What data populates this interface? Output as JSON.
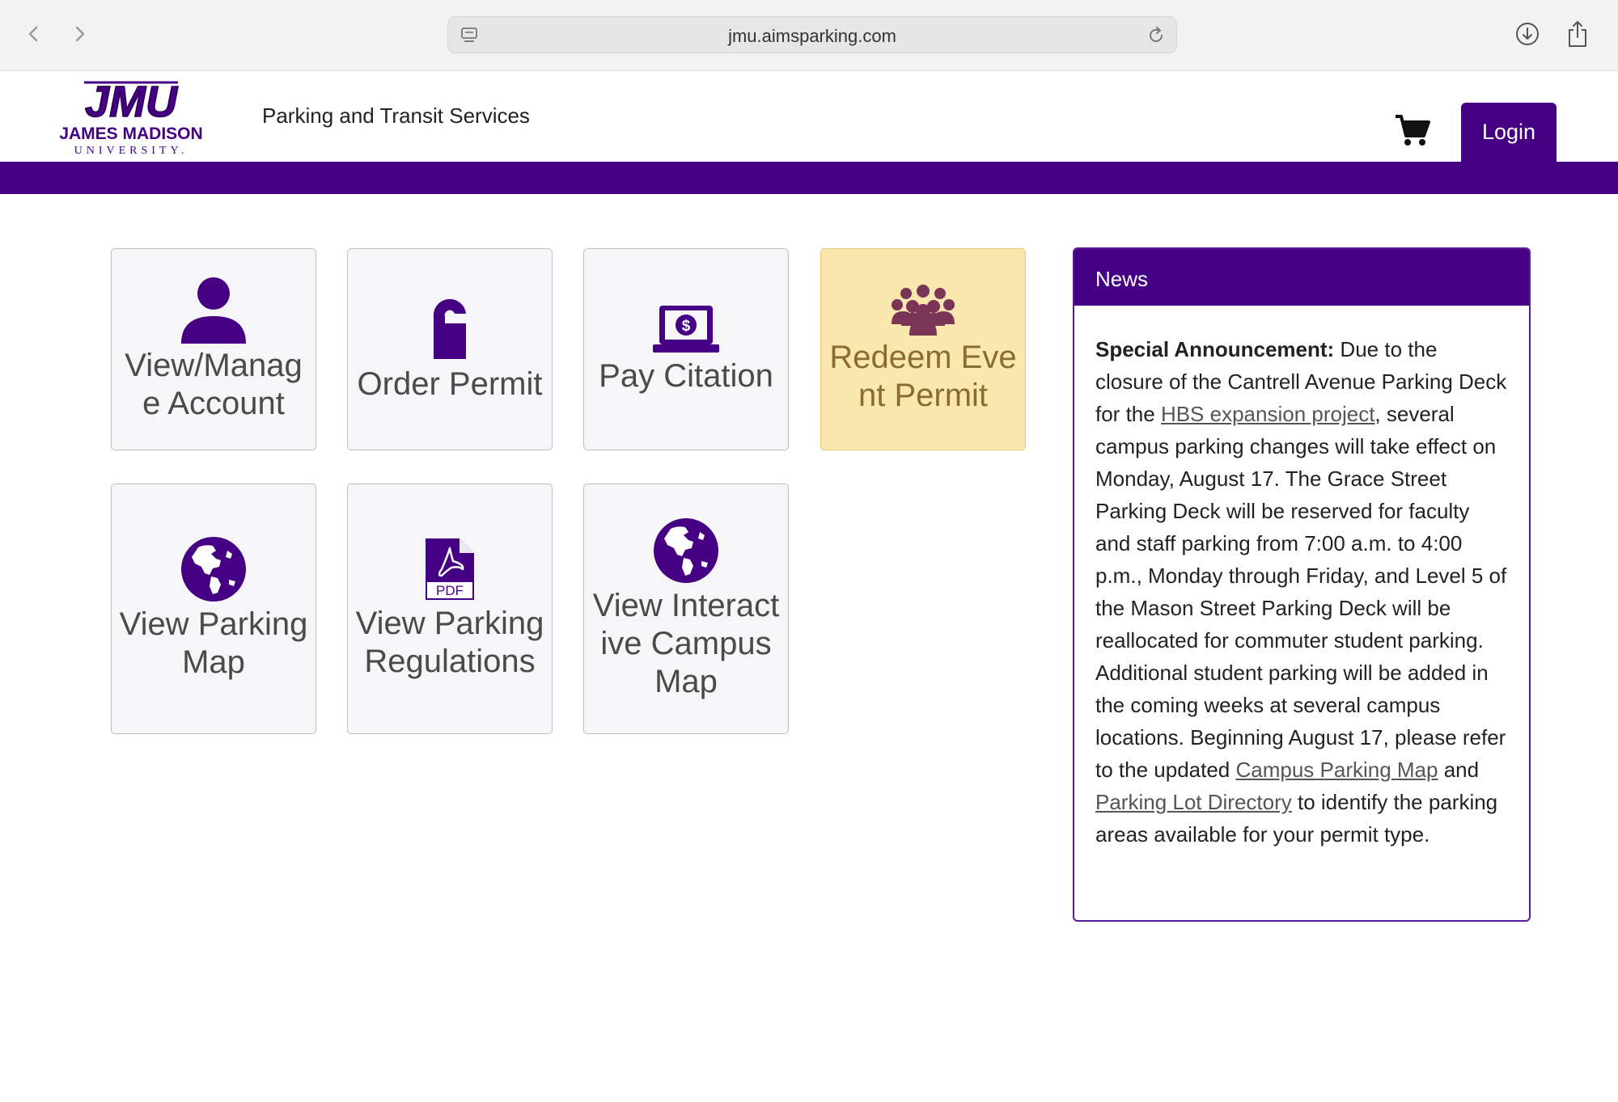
{
  "browser": {
    "url": "jmu.aimsparking.com"
  },
  "header": {
    "logo_text": "JMU",
    "logo_university": "JAMES MADISON",
    "logo_sub": "UNIVERSITY",
    "department": "Parking and Transit Services",
    "login_label": "Login"
  },
  "tiles": [
    {
      "label": "View/Manage Account",
      "icon": "person-icon"
    },
    {
      "label": "Order Permit",
      "icon": "door-hanger-icon"
    },
    {
      "label": "Pay Citation",
      "icon": "laptop-dollar-icon"
    },
    {
      "label": "Redeem Event Permit",
      "icon": "group-icon"
    },
    {
      "label": "View Parking Map",
      "icon": "globe-icon"
    },
    {
      "label": "View Parking Regulations",
      "icon": "pdf-icon"
    },
    {
      "label": "View Interactive Campus Map",
      "icon": "globe-icon"
    }
  ],
  "news": {
    "title": "News",
    "lead": "Special Announcement:",
    "text1": " Due to the closure of the Cantrell Avenue Parking Deck for the ",
    "link1": "HBS expansion project",
    "text2": ", several campus parking changes will take effect on Monday, August 17. The Grace Street Parking Deck will be reserved for faculty and staff parking from 7:00 a.m. to 4:00 p.m., Monday through Friday, and Level 5 of the Mason Street Parking Deck will be reallocated for commuter student parking. Additional student parking will be added in the coming weeks at several campus locations. Beginning August 17, please refer to the updated ",
    "link2": "Campus Parking Map",
    "text3": " and ",
    "link3": "Parking Lot Directory",
    "text4": " to identify the parking areas available for your permit type."
  },
  "colors": {
    "brand_purple": "#450084",
    "highlight_gold": "#f9e7ae"
  }
}
